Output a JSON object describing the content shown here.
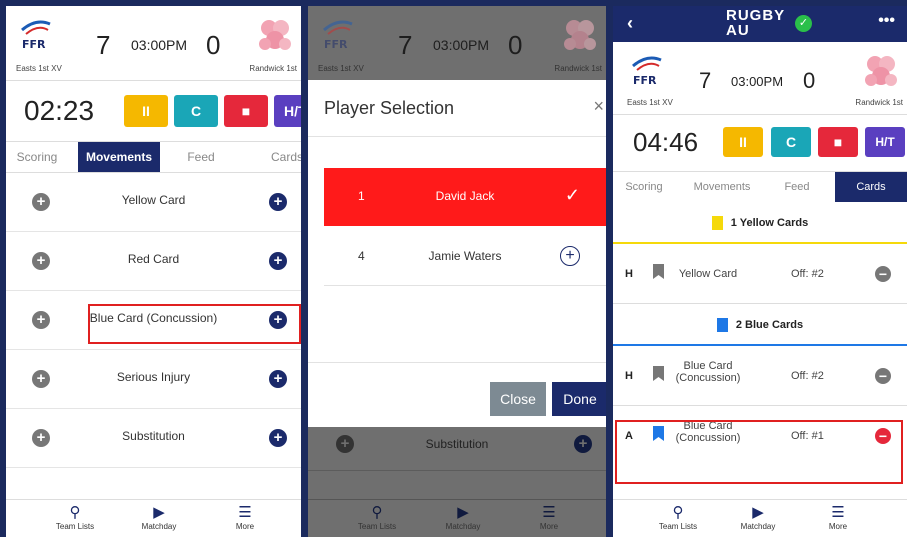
{
  "header": {
    "home_team": "Easts 1st XV",
    "away_team": "Randwick 1st",
    "home_score": "7",
    "away_score": "0",
    "time": "03:00PM"
  },
  "controls": {
    "pause_symbol": "II",
    "restart_symbol": "C",
    "stop_symbol": "■",
    "halftime_label": "H/T",
    "pause_color": "#f5b800",
    "restart_color": "#1aa6b7",
    "stop_color": "#e5283b",
    "halftime_color": "#5a3fc0"
  },
  "tabs": [
    "Scoring",
    "Movements",
    "Feed",
    "Cards"
  ],
  "left_screen": {
    "clock": "02:23",
    "active_tab": "Movements",
    "movements": [
      {
        "label": "Yellow Card"
      },
      {
        "label": "Red Card"
      },
      {
        "label": "Blue Card (Concussion)"
      },
      {
        "label": "Serious Injury"
      },
      {
        "label": "Substitution"
      }
    ]
  },
  "dialog": {
    "title": "Player Selection",
    "players": [
      {
        "number": "1",
        "name": "David Jack",
        "selected": true
      },
      {
        "number": "4",
        "name": "Jamie Waters",
        "selected": false
      }
    ],
    "close_label": "Close",
    "done_label": "Done",
    "behind_row": "Substitution"
  },
  "right_screen": {
    "brand_line1": "RUGBY",
    "brand_line2": "AU",
    "back_symbol": "‹",
    "more_symbol": "•••",
    "clock": "04:46",
    "active_tab": "Cards",
    "yellow_section": "1 Yellow Cards",
    "blue_section": "2 Blue Cards",
    "yellow_cards": [
      {
        "side": "H",
        "line1": "Yellow Card",
        "line2": "",
        "off": "Off: #2"
      }
    ],
    "blue_cards": [
      {
        "side": "H",
        "line1": "Blue Card",
        "line2": "(Concussion)",
        "off": "Off: #2"
      },
      {
        "side": "A",
        "line1": "Blue Card",
        "line2": "(Concussion)",
        "off": "Off: #1"
      }
    ]
  },
  "nav": [
    "Team Lists",
    "Matchday",
    "More"
  ],
  "colors": {
    "navy": "#1b2a6b",
    "highlight": "#e02020",
    "selected_row": "#ff1a1a",
    "yellow_flag": "#f5d90a",
    "blue_flag": "#1e78e6"
  }
}
